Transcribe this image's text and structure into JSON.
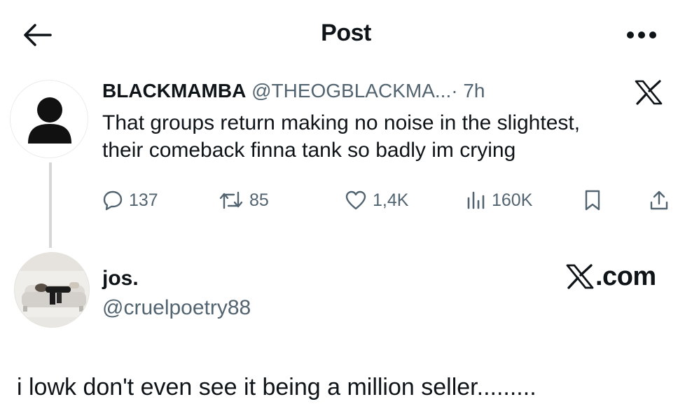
{
  "header": {
    "title": "Post",
    "back_icon": "arrow-left-icon",
    "more_icon": "more-horizontal-icon"
  },
  "quoted_post": {
    "author_name": "BLACKMAMBA",
    "author_handle": "@THEOGBLACKMA...",
    "separator": "·",
    "time": "7h",
    "avatar": "default-profile-icon",
    "platform_icon": "x-logo-icon",
    "text_line1": "That groups return making no noise in the slightest,",
    "text_line2": "their comeback finna tank so badly im crying",
    "actions": {
      "replies": "137",
      "reposts": "85",
      "likes": "1,4K",
      "views": "160K"
    }
  },
  "reply": {
    "author_name": "jos.",
    "author_handle": "@cruelpoetry88",
    "watermark": ".com",
    "text": "i lowk don't even see it being a million seller........."
  },
  "colors": {
    "text_primary": "#0f1419",
    "text_secondary": "#536471",
    "thread_line": "#d6d6d6"
  }
}
